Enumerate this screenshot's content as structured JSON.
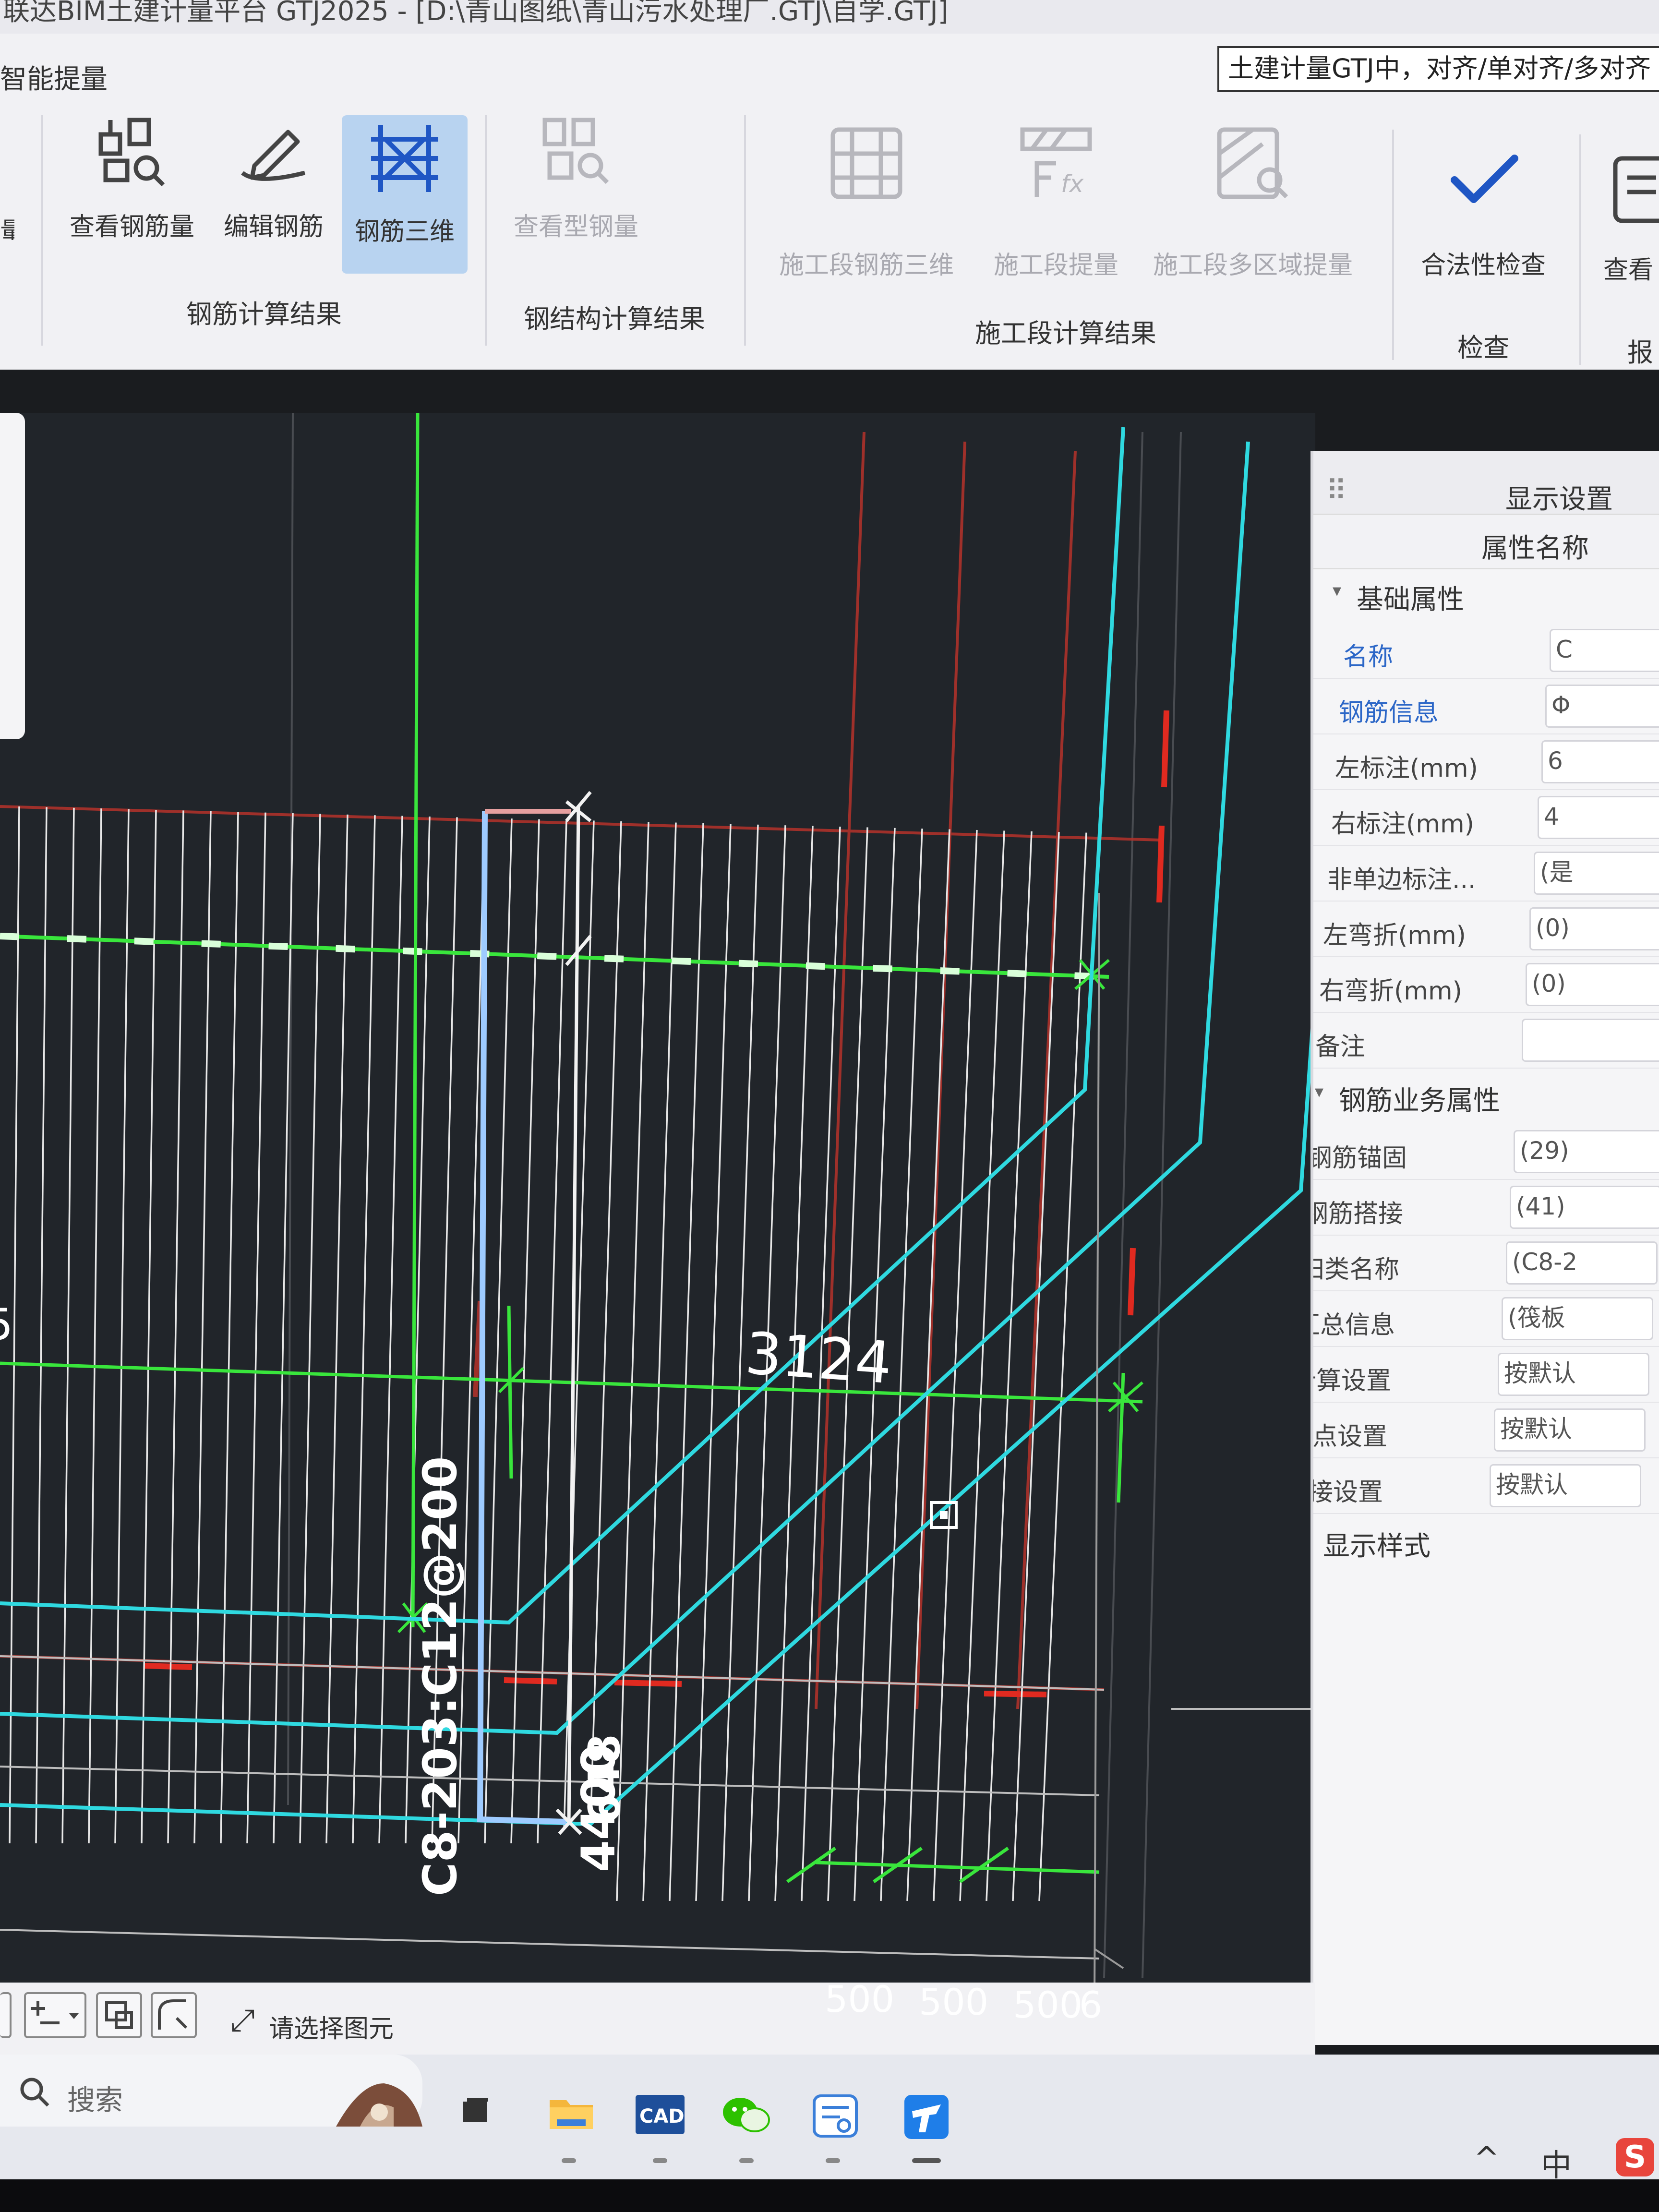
{
  "window": {
    "title": "联达BIM土建计量平台 GTJ2025 - [D:\\青山图纸\\青山污水处理厂.GTJ\\自学.GTJ]"
  },
  "ribbon": {
    "tab_label": "智能提量",
    "tooltip": "土建计量GTJ中，对齐/单对齐/多对齐",
    "buttons": [
      {
        "id": "view_rebar_qty",
        "label": "查看钢筋量",
        "icon": "rebar-table-icon",
        "state": "enabled"
      },
      {
        "id": "edit_rebar",
        "label": "编辑钢筋",
        "icon": "pen-icon",
        "state": "enabled"
      },
      {
        "id": "rebar_3d",
        "label": "钢筋三维",
        "icon": "rebar-3d-icon",
        "state": "active"
      },
      {
        "id": "view_steel",
        "label": "查看型钢量",
        "icon": "steel-table-icon",
        "state": "disabled"
      },
      {
        "id": "stage_rebar_3d",
        "label": "施工段钢筋三维",
        "icon": "stage-rebar-3d-icon",
        "state": "disabled"
      },
      {
        "id": "stage_qty",
        "label": "施工段提量",
        "icon": "formula-icon",
        "state": "disabled"
      },
      {
        "id": "stage_multi",
        "label": "施工段多区域提量",
        "icon": "multi-area-icon",
        "state": "disabled"
      },
      {
        "id": "validity_check",
        "label": "合法性检查",
        "icon": "checkmark-icon",
        "state": "enabled"
      },
      {
        "id": "view_report",
        "label": "查看",
        "icon": "report-icon",
        "state": "enabled"
      }
    ],
    "groups": [
      {
        "label": "钢筋计算结果"
      },
      {
        "label": "钢结构计算结果"
      },
      {
        "label": "施工段计算结果"
      },
      {
        "label": "检查"
      },
      {
        "label": "报"
      }
    ]
  },
  "canvas": {
    "labels": {
      "rebar_spec": "C8-203:C12@200",
      "dim_top": "648",
      "dim_main": "4400",
      "dim_diag": "3124",
      "left_edge": "5"
    },
    "scale_numbers": [
      "500",
      "500",
      "500",
      "6"
    ]
  },
  "properties_panel": {
    "title": "显示设置",
    "column_header": "属性名称",
    "sections": [
      {
        "title": "基础属性",
        "rows": [
          {
            "name": "名称",
            "value": "C",
            "highlight": true
          },
          {
            "name": "钢筋信息",
            "value": "Φ",
            "highlight": true
          },
          {
            "name": "左标注(mm)",
            "value": "6",
            "highlight": false
          },
          {
            "name": "右标注(mm)",
            "value": "4",
            "highlight": false
          },
          {
            "name": "非单边标注...",
            "value": "(是",
            "highlight": false
          },
          {
            "name": "左弯折(mm)",
            "value": "(0)",
            "highlight": false
          },
          {
            "name": "右弯折(mm)",
            "value": "(0)",
            "highlight": false
          },
          {
            "name": "备注",
            "value": "",
            "highlight": false
          }
        ]
      },
      {
        "title": "钢筋业务属性",
        "rows": [
          {
            "name": "钢筋锚固",
            "value": "(29)",
            "highlight": false
          },
          {
            "name": "钢筋搭接",
            "value": "(41)",
            "highlight": false
          },
          {
            "name": "归类名称",
            "value": "(C8-2",
            "highlight": false
          },
          {
            "name": "汇总信息",
            "value": "(筏板",
            "highlight": false
          },
          {
            "name": "计算设置",
            "value": "按默认",
            "highlight": false
          },
          {
            "name": "节点设置",
            "value": "按默认",
            "highlight": false
          },
          {
            "name": "搭接设置",
            "value": "按默认",
            "highlight": false
          }
        ]
      },
      {
        "title": "显示样式",
        "rows": []
      }
    ]
  },
  "status_bar": {
    "hint": "请选择图元"
  },
  "taskbar": {
    "search_placeholder": "搜索",
    "apps": [
      "landscape-widget-icon",
      "task-view-icon",
      "file-explorer-icon",
      "cad-app-icon",
      "wechat-icon",
      "notes-app-icon",
      "gtj-app-icon"
    ],
    "tray": {
      "ime": "中",
      "caret": "^",
      "app": "S"
    }
  },
  "colors": {
    "canvas_bg": "#22262b",
    "green_line": "#39e63c",
    "cyan_line": "#2fd9e0",
    "red_line": "#b8332a",
    "rebar_white": "#eeeeee",
    "selected_blue": "#7ab8ff",
    "active_button": "#b8d3f0"
  }
}
